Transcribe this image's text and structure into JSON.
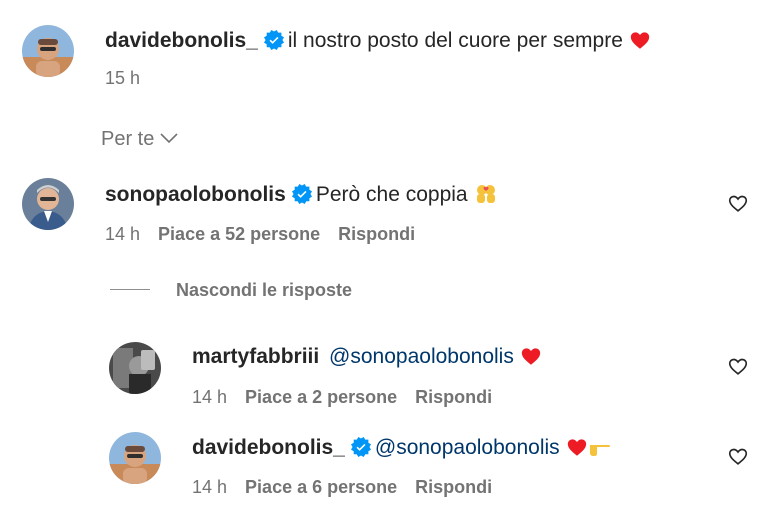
{
  "post_caption": {
    "username": "davidebonolis_",
    "text": "il nostro posto del cuore per sempre",
    "emoji": "red-heart",
    "time": "15 h"
  },
  "sort_label": "Per te",
  "comments": [
    {
      "username": "sonopaolobonolis",
      "text": "Però che coppia",
      "emoji": "couple-kissing",
      "time": "14 h",
      "likes": "Piace a 52 persone",
      "reply": "Rispondi"
    }
  ],
  "hide_replies_label": "Nascondi le risposte",
  "replies": [
    {
      "username": "martyfabbriii",
      "mention": "@sonopaolobonolis",
      "emoji": "red-heart",
      "time": "14 h",
      "likes": "Piace a 2 persone",
      "reply": "Rispondi"
    },
    {
      "username": "davidebonolis_",
      "mention": "@sonopaolobonolis",
      "emoji": "red-heart+pointing-hand",
      "time": "14 h",
      "likes": "Piace a 6 persone",
      "reply": "Rispondi"
    }
  ],
  "colors": {
    "verified": "#0095f6",
    "mention": "#00376b",
    "secondary": "#737373",
    "heart": "#ed4956"
  }
}
